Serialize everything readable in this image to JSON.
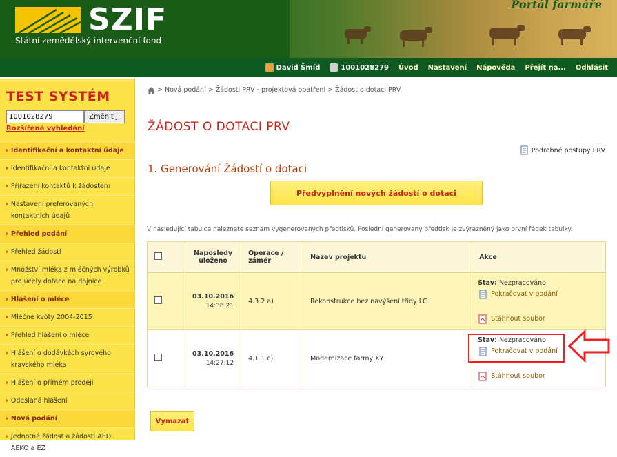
{
  "header": {
    "logo_text": "SZIF",
    "logo_subtitle": "Státní zemědělský intervenční fond",
    "portal_title": "Portál farmáře",
    "nav": {
      "user": "David Šmíd",
      "ji": "1001028279",
      "items": [
        "Úvod",
        "Nastavení",
        "Nápověda",
        "Přejít na...",
        "Odhlásit"
      ]
    },
    "colors": {
      "dark_green": "#0f5a23",
      "brand_green": "#1b5b18"
    }
  },
  "sidebar": {
    "title": "TEST SYSTÉM",
    "search_value": "1001028279",
    "search_button": "Změnit JI",
    "advanced_search": "Rozšířené vyhledání",
    "menu": [
      {
        "type": "section",
        "label": "Identifikační a kontaktní údaje"
      },
      {
        "type": "item",
        "label": "Identifikační a kontaktní údaje"
      },
      {
        "type": "item",
        "label": "Přiřazení kontaktů k žádostem"
      },
      {
        "type": "item",
        "label": "Nastavení preferovaných kontaktních údajů"
      },
      {
        "type": "section",
        "label": "Přehled podání"
      },
      {
        "type": "item",
        "label": "Přehled žádostí"
      },
      {
        "type": "item",
        "label": "Množství mléka z mléčných výrobků pro účely dotace na dojnice"
      },
      {
        "type": "section",
        "label": "Hlášení o mléce"
      },
      {
        "type": "item",
        "label": "Mléčné kvóty 2004-2015"
      },
      {
        "type": "item",
        "label": "Přehled hlášení o mléce"
      },
      {
        "type": "item",
        "label": "Hlášení o dodávkách syrového kravského mléka"
      },
      {
        "type": "item",
        "label": "Hlášení o přímém prodeji"
      },
      {
        "type": "item",
        "label": "Odeslaná hlášení"
      },
      {
        "type": "section",
        "label": "Nová podání"
      },
      {
        "type": "item",
        "label": "Jednotná žádost a žádosti AEO, AEKO a EZ"
      }
    ],
    "accent_color": "#c8261c",
    "background_color": "#fde34a"
  },
  "main": {
    "breadcrumb": [
      "Nová podání",
      "Žádosti PRV - projektová opatření",
      "Žádost o dotaci PRV"
    ],
    "title": "ŽÁDOST O DOTACI PRV",
    "help_link": "Podrobné postupy PRV",
    "section_title": "1. Generování Žádostí o dotaci",
    "prefill_button": "Předvyplnění nových žádostí o dotaci",
    "info_text": "V následující tabulce naleznete seznam vygenerovaných předtisků. Poslední generovaný předtisk je zvýrazněný jako první řádek tabulky.",
    "table": {
      "headers": [
        "Naposledy uloženo",
        "Operace / záměr",
        "Název projektu",
        "Akce"
      ],
      "rows": [
        {
          "date": "03.10.2016",
          "time": "14:38:21",
          "operation": "4.3.2 a)",
          "project": "Rekonstrukce bez navýšení třídy LC",
          "status_label": "Stav:",
          "status": "Nezpracováno",
          "continue": "Pokračovat v podání",
          "download": "Stáhnout soubor",
          "highlighted": true
        },
        {
          "date": "03.10.2016",
          "time": "14:27:12",
          "operation": "4.1.1 c)",
          "project": "Modernizace farmy XY",
          "status_label": "Stav:",
          "status": "Nezpracováno",
          "continue": "Pokračovat v podání",
          "download": "Stáhnout soubor",
          "highlighted": false
        }
      ]
    },
    "delete_button": "Vymazat",
    "annotation_color": "#ee2222"
  }
}
